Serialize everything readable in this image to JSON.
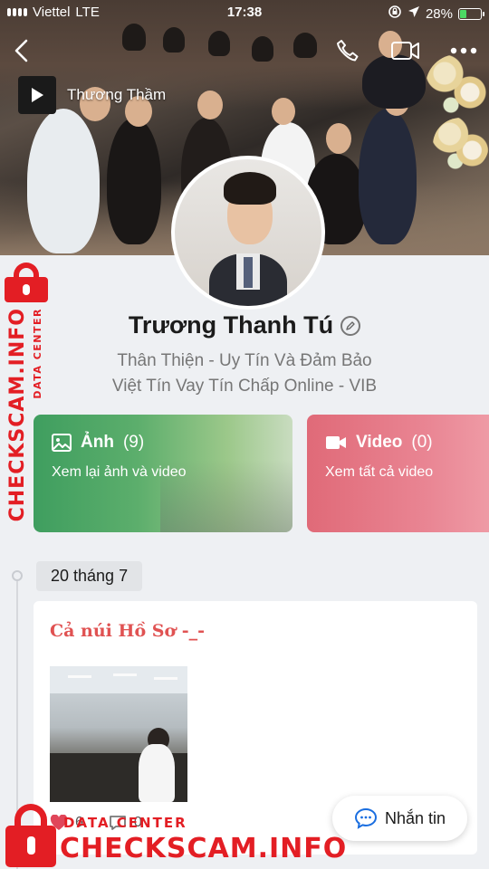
{
  "status_bar": {
    "carrier": "Viettel",
    "network": "LTE",
    "time": "17:38",
    "battery": "28%"
  },
  "cover": {
    "music_title": "Thương Thầm"
  },
  "profile": {
    "name": "Trương Thanh Tú",
    "bio_line1": "Thân Thiện - Uy Tín Và Đảm Bảo",
    "bio_line2": "Việt Tín Vay Tín Chấp Online - VIB"
  },
  "media": {
    "photos_label": "Ảnh",
    "photos_count": "(9)",
    "photos_sub": "Xem lại ảnh và video",
    "videos_label": "Video",
    "videos_count": "(0)",
    "videos_sub": "Xem tất cả video"
  },
  "timeline": {
    "date": "20 tháng 7",
    "post_caption": "Cả núi Hồ Sơ -_-",
    "likes": "6",
    "comments": "0"
  },
  "message_button": "Nhắn tin",
  "watermark": {
    "data_center": "DATA CENTER",
    "site": "CHECKSCAM.INFO"
  },
  "colors": {
    "photos_card": "#4fa766",
    "videos_card": "#e5707e",
    "caption": "#e05252",
    "watermark": "#e31e24"
  }
}
